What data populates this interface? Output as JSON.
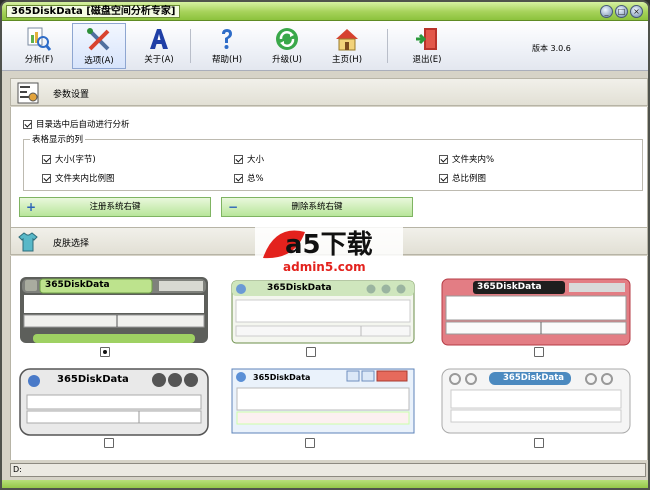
{
  "window": {
    "title": "365DiskData [磁盘空间分析专家]"
  },
  "titlebar_buttons": [
    {
      "label": "_",
      "icon": "minimize-icon"
    },
    {
      "label": "□",
      "icon": "maximize-icon"
    },
    {
      "label": "×",
      "icon": "close-icon"
    }
  ],
  "toolbar": {
    "items": [
      {
        "label": "分析(F)",
        "icon": "analyze-magnifier-icon"
      },
      {
        "label": "选项(A)",
        "icon": "tools-options-icon",
        "active": true
      },
      {
        "label": "关于(A)",
        "icon": "about-a-icon"
      },
      {
        "label": "帮助(H)",
        "icon": "help-question-icon"
      },
      {
        "label": "升级(U)",
        "icon": "upgrade-refresh-icon"
      },
      {
        "label": "主页(H)",
        "icon": "home-icon"
      },
      {
        "label": "退出(E)",
        "icon": "exit-door-icon"
      }
    ],
    "version": "版本 3.0.6"
  },
  "params": {
    "title": "参数设置",
    "auto_analyze": "目录选中后自动进行分析",
    "columns_legend": "表格显示的列",
    "columns": [
      {
        "label": "大小(字节)",
        "checked": true
      },
      {
        "label": "大小",
        "checked": true
      },
      {
        "label": "文件夹内%",
        "checked": true
      },
      {
        "label": "文件夹内比例图",
        "checked": true
      },
      {
        "label": "总%",
        "checked": true
      },
      {
        "label": "总比例图",
        "checked": true
      }
    ],
    "register_button": "注册系统右键",
    "remove_button": "删除系统右键"
  },
  "skins": {
    "title": "皮肤选择",
    "items": [
      {
        "name": "365DiskData",
        "selected": true
      },
      {
        "name": "365DiskData",
        "selected": false
      },
      {
        "name": "365DiskData",
        "selected": false
      },
      {
        "name": "365DiskData",
        "selected": false
      },
      {
        "name": "365DiskData",
        "selected": false
      },
      {
        "name": "365DiskData",
        "selected": false
      }
    ]
  },
  "watermark": {
    "brand": "a5下载",
    "url": "admin5.com"
  },
  "status": {
    "text": "D:"
  }
}
